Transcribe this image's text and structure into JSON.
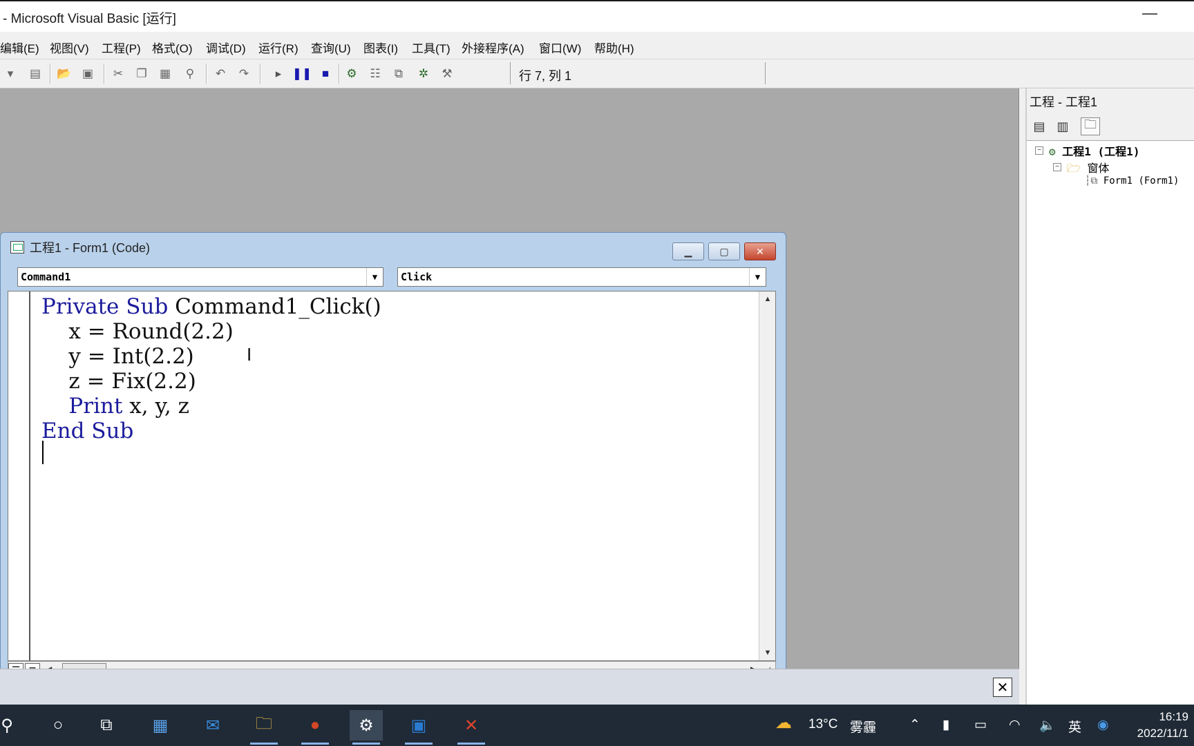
{
  "window": {
    "title": "- Microsoft Visual Basic [运行]",
    "minimize_glyph": "—"
  },
  "menu": [
    "编辑(E)",
    "视图(V)",
    "工程(P)",
    "格式(O)",
    "调试(D)",
    "运行(R)",
    "查询(U)",
    "图表(I)",
    "工具(T)",
    "外接程序(A)",
    "窗口(W)",
    "帮助(H)"
  ],
  "toolbar": {
    "position_text": "行 7, 列 1",
    "icons": [
      "add-item-icon",
      "menu-editor-icon",
      "open-project-icon",
      "save-project-icon",
      "cut-icon",
      "copy-icon",
      "paste-icon",
      "find-icon",
      "undo-icon",
      "redo-icon",
      "start-icon",
      "break-icon",
      "end-icon",
      "project-explorer-icon",
      "properties-window-icon",
      "form-layout-icon",
      "object-browser-icon",
      "toolbox-icon"
    ]
  },
  "code_window": {
    "title": "工程1 - Form1 (Code)",
    "object_combo": "Command1",
    "procedure_combo": "Click",
    "lines": [
      {
        "kw": "Private Sub",
        "rest": " Command1_Click()"
      },
      {
        "kw": "",
        "rest": "    x = Round(2.2)"
      },
      {
        "kw": "",
        "rest": "    y = Int(2.2)"
      },
      {
        "kw": "",
        "rest": "    z = Fix(2.2)"
      },
      {
        "kw": "    Print",
        "rest": " x, y, z"
      },
      {
        "kw": "End Sub",
        "rest": ""
      }
    ]
  },
  "project": {
    "header": "工程 - 工程1",
    "root": "工程1 (工程1)",
    "folder": "窗体",
    "form": "Form1 (Form1)"
  },
  "taskbar": {
    "weather_temp": "13°C",
    "weather_desc": "雾霾",
    "ime": "英",
    "time": "16:19",
    "date": "2022/11/1"
  },
  "colors": {
    "keyword": "#1c1c9c",
    "mdi_background": "#a9a9a9",
    "taskbar": "#1f2a36"
  }
}
